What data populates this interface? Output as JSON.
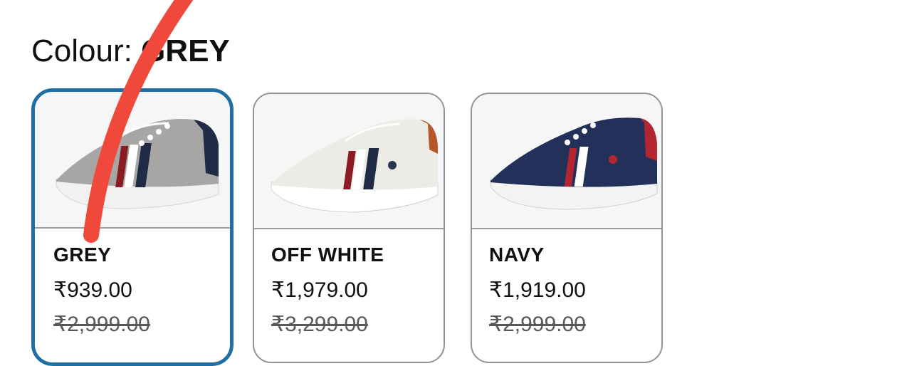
{
  "colour": {
    "label": "Colour: ",
    "value": "GREY"
  },
  "variants": [
    {
      "name": "GREY",
      "price": "₹939.00",
      "mrp": "₹2,999.00",
      "selected": true
    },
    {
      "name": "OFF WHITE",
      "price": "₹1,979.00",
      "mrp": "₹3,299.00",
      "selected": false
    },
    {
      "name": "NAVY",
      "price": "₹1,919.00",
      "mrp": "₹2,999.00",
      "selected": false
    }
  ],
  "colors": {
    "selected_border": "#1f6fa3",
    "card_border": "#8f9595",
    "annotation_stroke": "#f0483b"
  }
}
